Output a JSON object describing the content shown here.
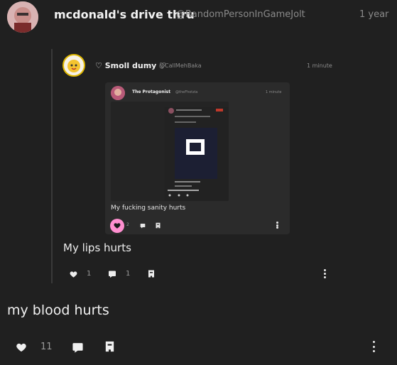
{
  "main_post": {
    "author_name": "mcdonald's drive thru",
    "handle": "@RandomPersonInGameJolt",
    "time": "1 year",
    "body": "my blood hurts",
    "like_count": "11"
  },
  "quoted_post": {
    "author_name": "♡ Smoll dumy ♡",
    "handle": "@CallMehBaka",
    "time": "1 minute",
    "body": "My lips hurts",
    "like_count": "1",
    "comment_count": "1"
  },
  "nested_post": {
    "author_name": "The Protagonist",
    "handle": "@theFhotzia",
    "time": "1 minute",
    "body": "My fucking sanity hurts",
    "like_count": "2"
  },
  "colors": {
    "background": "#202020",
    "quote_card": "#2b2b2b",
    "like_active": "#ff8fd0",
    "text": "#e8e8e8",
    "muted": "#8a8a8a"
  }
}
